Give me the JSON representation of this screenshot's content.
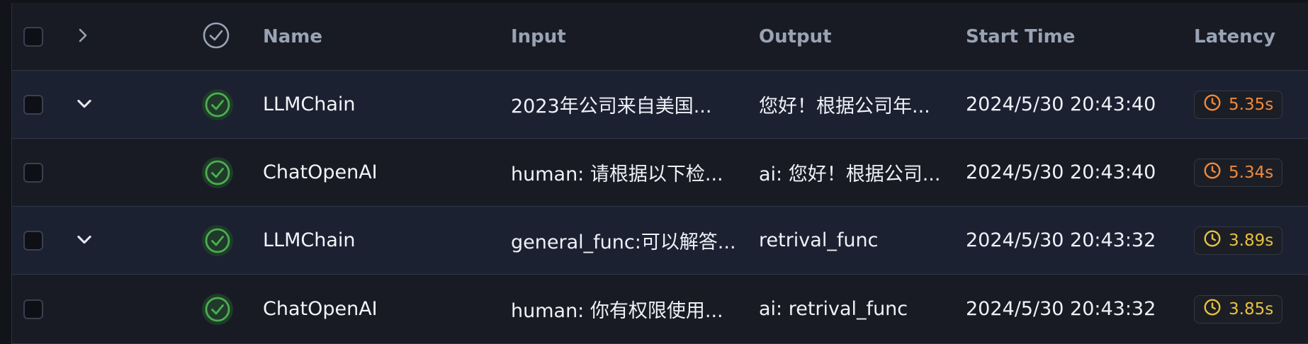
{
  "header": {
    "name": "Name",
    "input": "Input",
    "output": "Output",
    "start_time": "Start Time",
    "latency": "Latency"
  },
  "rows": [
    {
      "name": "LLMChain",
      "input": "2023年公司来自美国...",
      "output": "您好！根据公司年...",
      "start_time": "2024/5/30 20:43:40",
      "latency": "5.35s",
      "latency_color": "#f08a3c",
      "expandable": true,
      "status": "success"
    },
    {
      "name": "ChatOpenAI",
      "input": "human: 请根据以下检...",
      "output": "ai: 您好！根据公司...",
      "start_time": "2024/5/30 20:43:40",
      "latency": "5.34s",
      "latency_color": "#f08a3c",
      "expandable": false,
      "status": "success"
    },
    {
      "name": "LLMChain",
      "input": "general_func:可以解答...",
      "output": "retrival_func",
      "start_time": "2024/5/30 20:43:32",
      "latency": "3.89s",
      "latency_color": "#e6c140",
      "expandable": true,
      "status": "success"
    },
    {
      "name": "ChatOpenAI",
      "input": "human: 你有权限使用...",
      "output": "ai: retrival_func",
      "start_time": "2024/5/30 20:43:32",
      "latency": "3.85s",
      "latency_color": "#e6c140",
      "expandable": false,
      "status": "success"
    }
  ],
  "colors": {
    "background": "#181b24",
    "row_alt": "#1b2131",
    "success_green": "#4caf50",
    "header_text": "#9aa3b4"
  },
  "icons": {
    "header_expand": "chevron-right-icon",
    "row_expand": "chevron-down-icon",
    "status": "check-circle-icon",
    "latency": "clock-icon"
  }
}
